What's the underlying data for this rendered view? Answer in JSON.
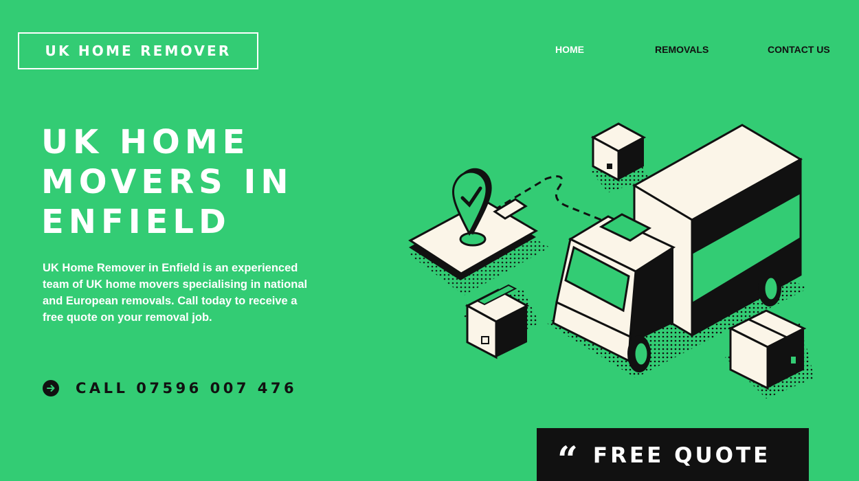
{
  "brand": {
    "logo_text": "UK HOME REMOVER"
  },
  "nav": {
    "items": [
      {
        "label": "HOME",
        "active": true
      },
      {
        "label": "REMOVALS",
        "active": false
      },
      {
        "label": "CONTACT US",
        "active": false
      }
    ]
  },
  "hero": {
    "title_lines": [
      "UK HOME",
      "MOVERS IN",
      "ENFIELD"
    ],
    "description": "UK Home Remover in Enfield is an experienced team of UK home movers specialising in national and European removals. Call today to receive a free quote on your removal job."
  },
  "cta": {
    "call_label": "CALL 07596 007 476",
    "call_icon": "arrow-right-circle-icon",
    "quote_label": "FREE QUOTE",
    "quote_icon": "quote-mark-icon"
  },
  "illustration": {
    "name": "isometric-moving-truck-illustration"
  },
  "colors": {
    "background": "#33cc74",
    "text_light": "#ffffff",
    "text_dark": "#111111",
    "illustration_cream": "#fbf5e8"
  }
}
